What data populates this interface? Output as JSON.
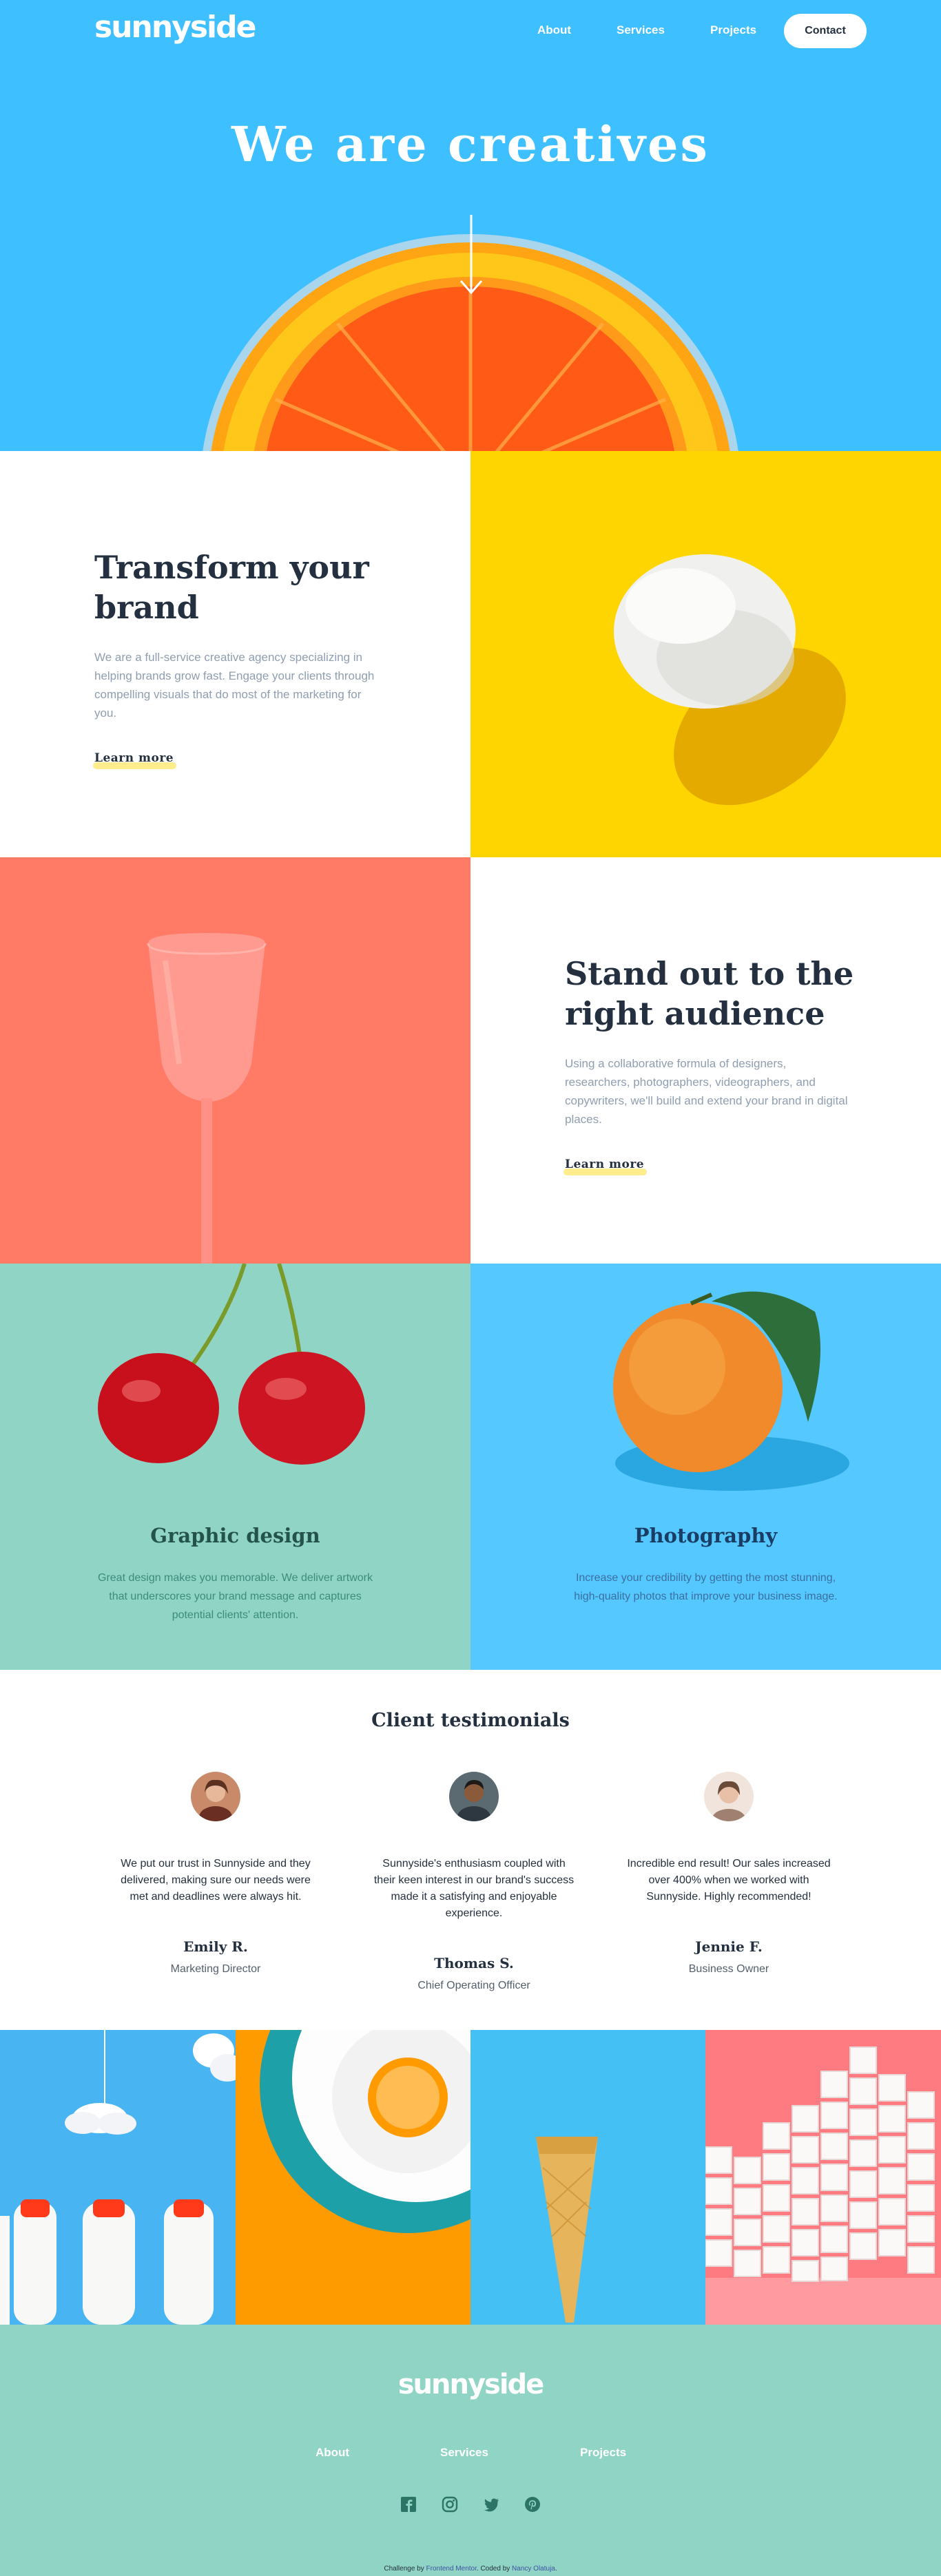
{
  "header": {
    "logo": "sunnyside",
    "nav": [
      "About",
      "Services",
      "Projects"
    ],
    "contact_label": "Contact",
    "hero_title": "We are creatives"
  },
  "transform": {
    "title": "Transform your brand",
    "text": "We are a full-service creative agency specializing in helping brands grow fast. Engage your clients through compelling visuals that do most of the marketing for you.",
    "link": "Learn more"
  },
  "standout": {
    "title": "Stand out to the right audience",
    "text": "Using a collaborative formula of designers, researchers, photographers, videographers, and copywriters, we'll build and extend your brand in digital places.",
    "link": "Learn more"
  },
  "services": [
    {
      "title": "Graphic design",
      "text": "Great design makes you memorable. We deliver artwork that underscores your brand message and captures potential clients' attention."
    },
    {
      "title": "Photography",
      "text": "Increase your credibility by getting the most stunning, high-quality photos that improve your business image."
    }
  ],
  "testimonials": {
    "heading": "Client testimonials",
    "items": [
      {
        "quote": "We put our trust in Sunnyside and they delivered, making sure our needs were met and deadlines were always hit.",
        "name": "Emily R.",
        "role": "Marketing Director"
      },
      {
        "quote": "Sunnyside's enthusiasm coupled with their keen interest in our brand's success made it a satisfying and enjoyable experience.",
        "name": "Thomas S.",
        "role": "Chief Operating Officer"
      },
      {
        "quote": "Incredible end result! Our sales increased over 400% when we worked with Sunnyside. Highly recommended!",
        "name": "Jennie F.",
        "role": "Business Owner"
      }
    ]
  },
  "footer": {
    "logo": "sunnyside",
    "nav": [
      "About",
      "Services",
      "Projects"
    ],
    "social_icons": [
      "facebook-icon",
      "instagram-icon",
      "twitter-icon",
      "pinterest-icon"
    ],
    "credit_prefix": "Challenge by",
    "credit_link1": "Frontend Mentor",
    "credit_mid": ". Coded by",
    "credit_link2": "Nancy Olatuja",
    "credit_suffix": "."
  },
  "colors": {
    "hero_blue": "#3ebfff",
    "yellow": "#fed500",
    "coral": "#ff7b66",
    "teal": "#90d4c5",
    "sky": "#55c8ff"
  }
}
